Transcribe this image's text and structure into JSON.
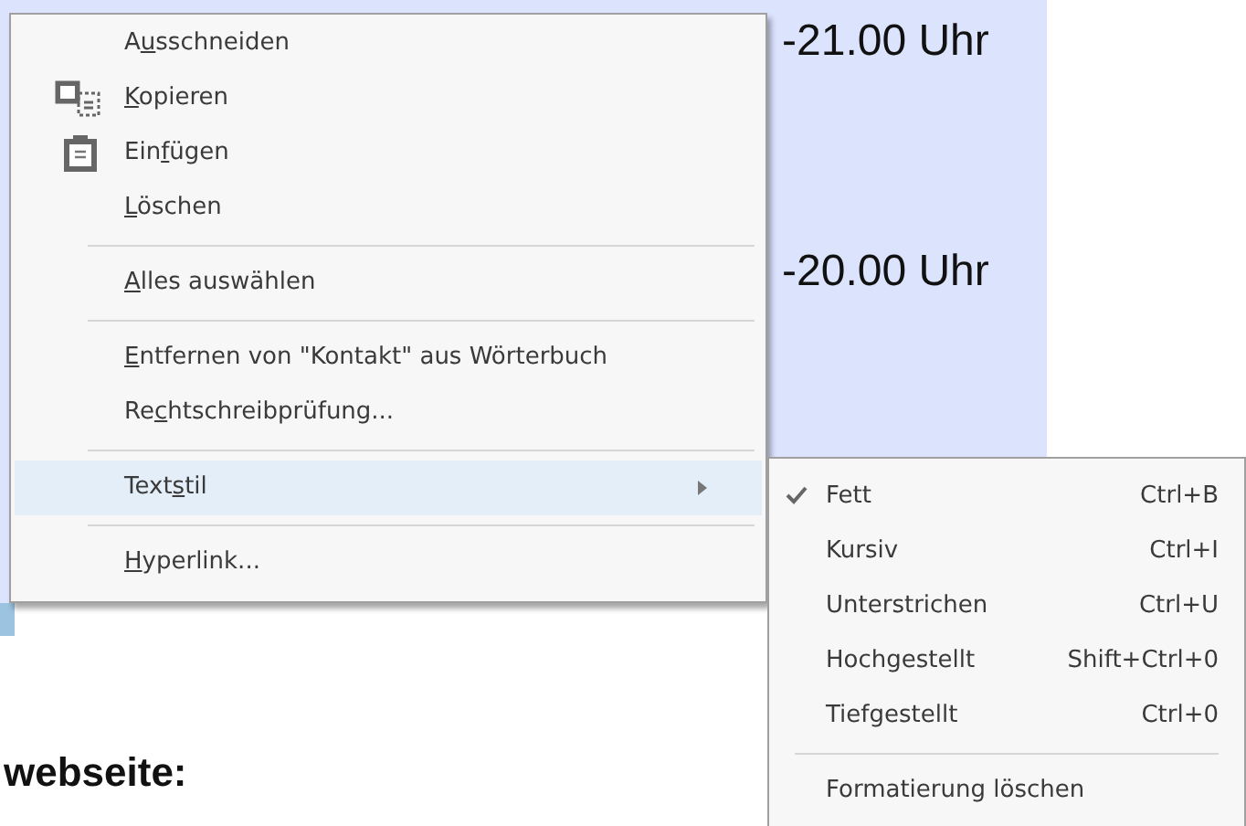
{
  "page": {
    "times": [
      "-21.00 Uhr",
      "-20.00 Uhr"
    ],
    "heading": "webseite:"
  },
  "context_menu": {
    "items": [
      {
        "kind": "item",
        "pre": "A",
        "key": "u",
        "post": "sschneiden"
      },
      {
        "kind": "item",
        "key": "K",
        "post": "opieren"
      },
      {
        "kind": "item",
        "pre": "Ein",
        "key": "f",
        "post": "ügen"
      },
      {
        "kind": "item",
        "key": "L",
        "post": "öschen"
      },
      {
        "kind": "separator"
      },
      {
        "kind": "item",
        "key": "A",
        "post": "lles auswählen"
      },
      {
        "kind": "separator"
      },
      {
        "kind": "item",
        "key": "E",
        "post": "ntfernen von \"Kontakt\" aus Wörterbuch"
      },
      {
        "kind": "item",
        "pre": "Re",
        "key": "c",
        "post": "htschreibprüfung..."
      },
      {
        "kind": "separator"
      },
      {
        "kind": "submenu",
        "pre": "Text",
        "key": "s",
        "post": "til",
        "selected": true
      },
      {
        "kind": "separator"
      },
      {
        "kind": "item",
        "key": "H",
        "post": "yperlink..."
      }
    ]
  },
  "submenu": {
    "items": [
      {
        "kind": "item",
        "label": "Fett",
        "shortcut": "Ctrl+B",
        "checked": true
      },
      {
        "kind": "item",
        "label": "Kursiv",
        "shortcut": "Ctrl+I",
        "checked": false
      },
      {
        "kind": "item",
        "label": "Unterstrichen",
        "shortcut": "Ctrl+U",
        "checked": false
      },
      {
        "kind": "item",
        "label": "Hochgestellt",
        "shortcut": "Shift+Ctrl+0",
        "checked": false
      },
      {
        "kind": "item",
        "label": "Tiefgestellt",
        "shortcut": "Ctrl+0",
        "checked": false
      },
      {
        "kind": "separator"
      },
      {
        "kind": "item",
        "label": "Formatierung löschen",
        "checked": false
      }
    ]
  }
}
